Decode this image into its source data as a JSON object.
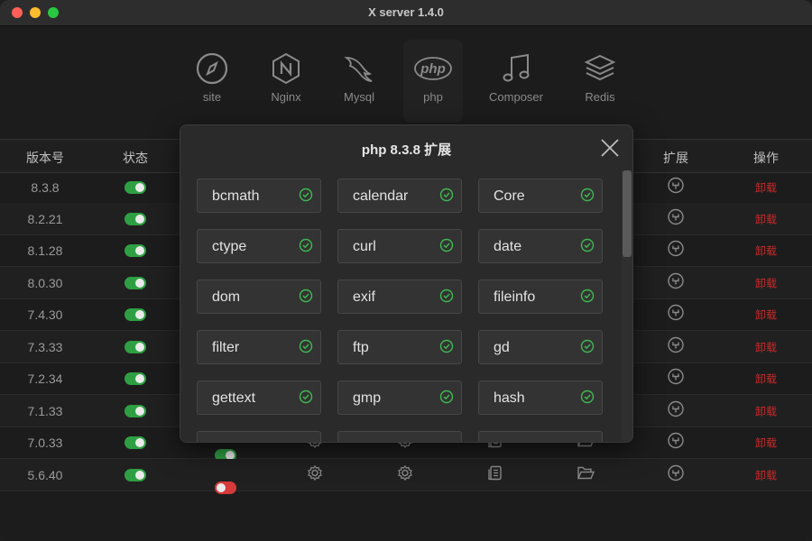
{
  "window": {
    "title": "X server 1.4.0"
  },
  "toolbar": {
    "items": [
      {
        "label": "site",
        "icon": "compass-icon"
      },
      {
        "label": "Nginx",
        "icon": "nginx-icon"
      },
      {
        "label": "Mysql",
        "icon": "mysql-dolphin-icon"
      },
      {
        "label": "php",
        "icon": "php-icon"
      },
      {
        "label": "Composer",
        "icon": "music-note-icon"
      },
      {
        "label": "Redis",
        "icon": "layers-icon"
      }
    ],
    "active": "php"
  },
  "table": {
    "headers": {
      "version": "版本号",
      "status": "状态",
      "extensions": "扩展",
      "actions": "操作"
    },
    "rows": [
      {
        "version": "8.3.8",
        "enabled": true,
        "action": "卸载"
      },
      {
        "version": "8.2.21",
        "enabled": true,
        "action": "卸载"
      },
      {
        "version": "8.1.28",
        "enabled": true,
        "action": "卸载"
      },
      {
        "version": "8.0.30",
        "enabled": true,
        "action": "卸载"
      },
      {
        "version": "7.4.30",
        "enabled": true,
        "action": "卸载"
      },
      {
        "version": "7.3.33",
        "enabled": true,
        "action": "卸载"
      },
      {
        "version": "7.2.34",
        "enabled": true,
        "action": "卸载"
      },
      {
        "version": "7.1.33",
        "enabled": true,
        "action": "卸载"
      },
      {
        "version": "7.0.33",
        "enabled": true,
        "second_enabled": true,
        "action": "卸载"
      },
      {
        "version": "5.6.40",
        "enabled": true,
        "second_enabled": false,
        "action": "卸载"
      }
    ]
  },
  "modal": {
    "title": "php 8.3.8 扩展",
    "extensions": [
      "bcmath",
      "calendar",
      "Core",
      "ctype",
      "curl",
      "date",
      "dom",
      "exif",
      "fileinfo",
      "filter",
      "ftp",
      "gd",
      "gettext",
      "gmp",
      "hash"
    ]
  },
  "colors": {
    "toggle_on": "#2ea043",
    "toggle_off": "#d73a3a",
    "uninstall": "#c72a2a",
    "check": "#3fb950"
  }
}
